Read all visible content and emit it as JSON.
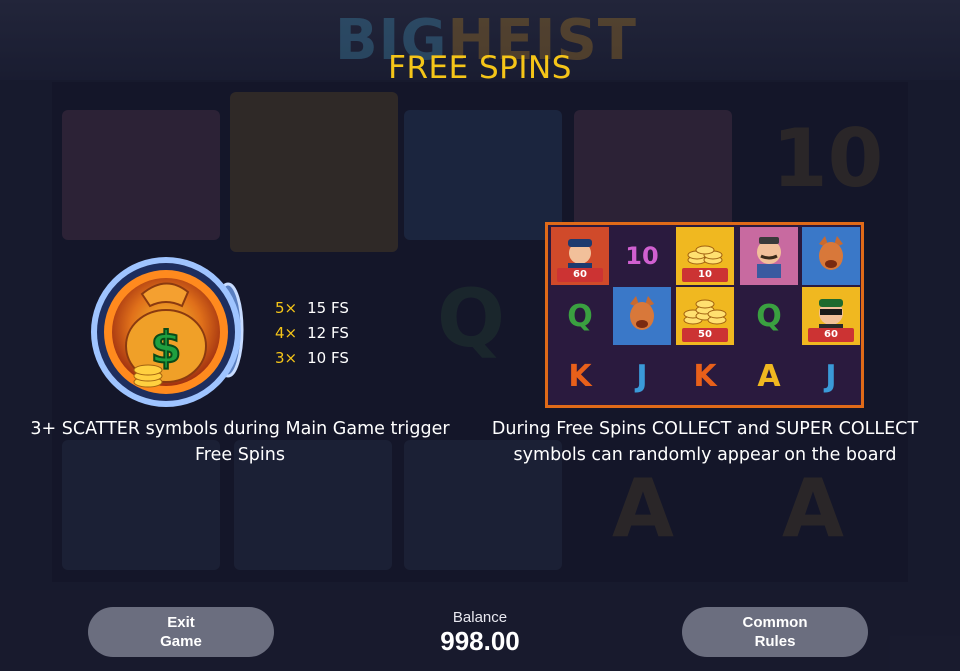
{
  "background": {
    "logo_part1": "BIG",
    "logo_part2": "HEIST"
  },
  "title": "FREE SPINS",
  "scatter": {
    "icon": "money-bag-scatter-icon",
    "paytable": [
      {
        "mult": "5×",
        "fs": "15 FS"
      },
      {
        "mult": "4×",
        "fs": "12 FS"
      },
      {
        "mult": "3×",
        "fs": "10 FS"
      }
    ],
    "description_line1": "3+ SCATTER symbols during Main Game trigger",
    "description_line2": "Free Spins"
  },
  "board": {
    "row1": [
      {
        "symbol": "police-officer-icon",
        "value": "60"
      },
      {
        "symbol": "ten-icon",
        "text": "10"
      },
      {
        "symbol": "coins-collect-icon",
        "value": "10"
      },
      {
        "symbol": "detective-icon",
        "value": ""
      },
      {
        "symbol": "dog-icon",
        "value": ""
      }
    ],
    "row2": [
      {
        "symbol": "q-icon",
        "text": "Q"
      },
      {
        "symbol": "dog-icon",
        "value": ""
      },
      {
        "symbol": "coins-collect-icon",
        "value": "50"
      },
      {
        "symbol": "q-icon",
        "text": "Q"
      },
      {
        "symbol": "robber-icon",
        "value": "60"
      }
    ],
    "row3": [
      {
        "symbol": "k-icon",
        "text": "K"
      },
      {
        "symbol": "j-icon",
        "text": "J"
      },
      {
        "symbol": "k-icon",
        "text": "K"
      },
      {
        "symbol": "a-icon",
        "text": "A"
      },
      {
        "symbol": "j-icon",
        "text": "J"
      }
    ],
    "description_line1": "During Free Spins COLLECT and SUPER COLLECT",
    "description_line2": "symbols can randomly appear on the board"
  },
  "controls": {
    "exit_line1": "Exit",
    "exit_line2": "Game",
    "balance_label": "Balance",
    "balance_value": "998.00",
    "rules_line1": "Common",
    "rules_line2": "Rules"
  },
  "colors": {
    "title": "#f5c518",
    "multiplier": "#f5c518",
    "board_border": "#e06a18",
    "button": "#6b6e7f"
  }
}
